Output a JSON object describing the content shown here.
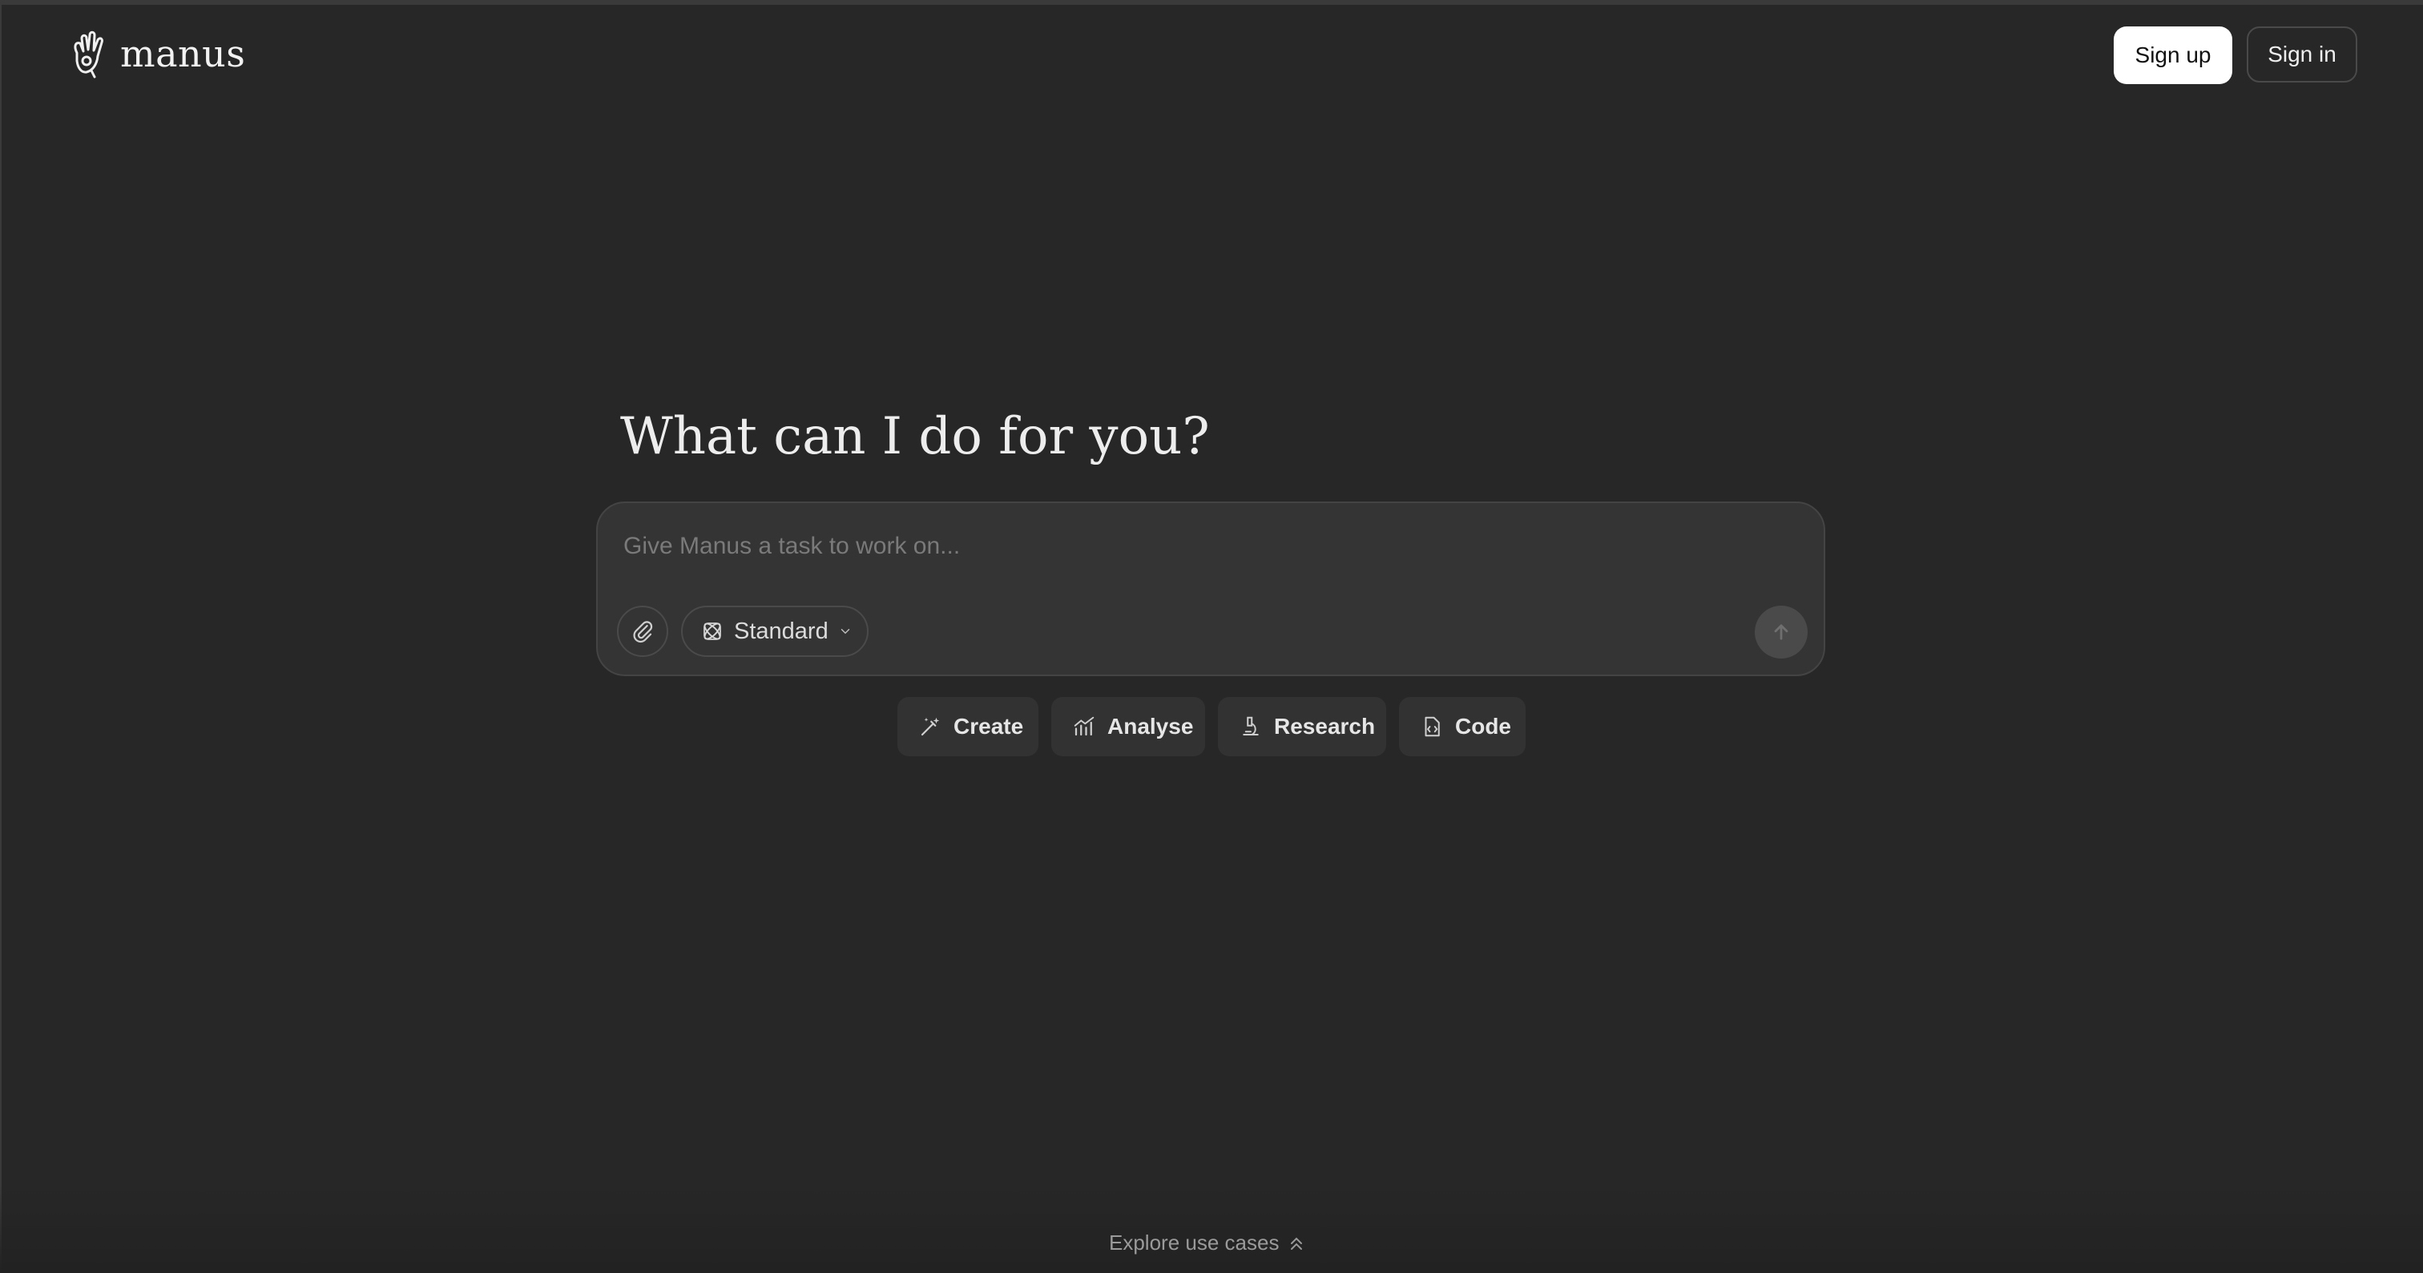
{
  "colors": {
    "background": "#272727",
    "composer": "#343434",
    "primary_button": "#ffffff"
  },
  "header": {
    "brand": "manus",
    "logo_icon": "hand-logo-icon",
    "sign_up_label": "Sign up",
    "sign_in_label": "Sign in"
  },
  "main": {
    "heading": "What can I do for you?",
    "composer": {
      "placeholder": "Give Manus a task to work on...",
      "value": "",
      "attach_icon": "paperclip-icon",
      "mode_icon": "atom-icon",
      "mode_label": "Standard",
      "mode_chevron_icon": "chevron-down-icon",
      "send_icon": "arrow-up-icon"
    },
    "chips": [
      {
        "label": "Create",
        "icon": "magic-wand-icon"
      },
      {
        "label": "Analyse",
        "icon": "bar-chart-icon"
      },
      {
        "label": "Research",
        "icon": "microscope-icon"
      },
      {
        "label": "Code",
        "icon": "code-file-icon"
      }
    ]
  },
  "footer": {
    "explore_label": "Explore use cases",
    "explore_icon": "double-chevron-up-icon"
  }
}
